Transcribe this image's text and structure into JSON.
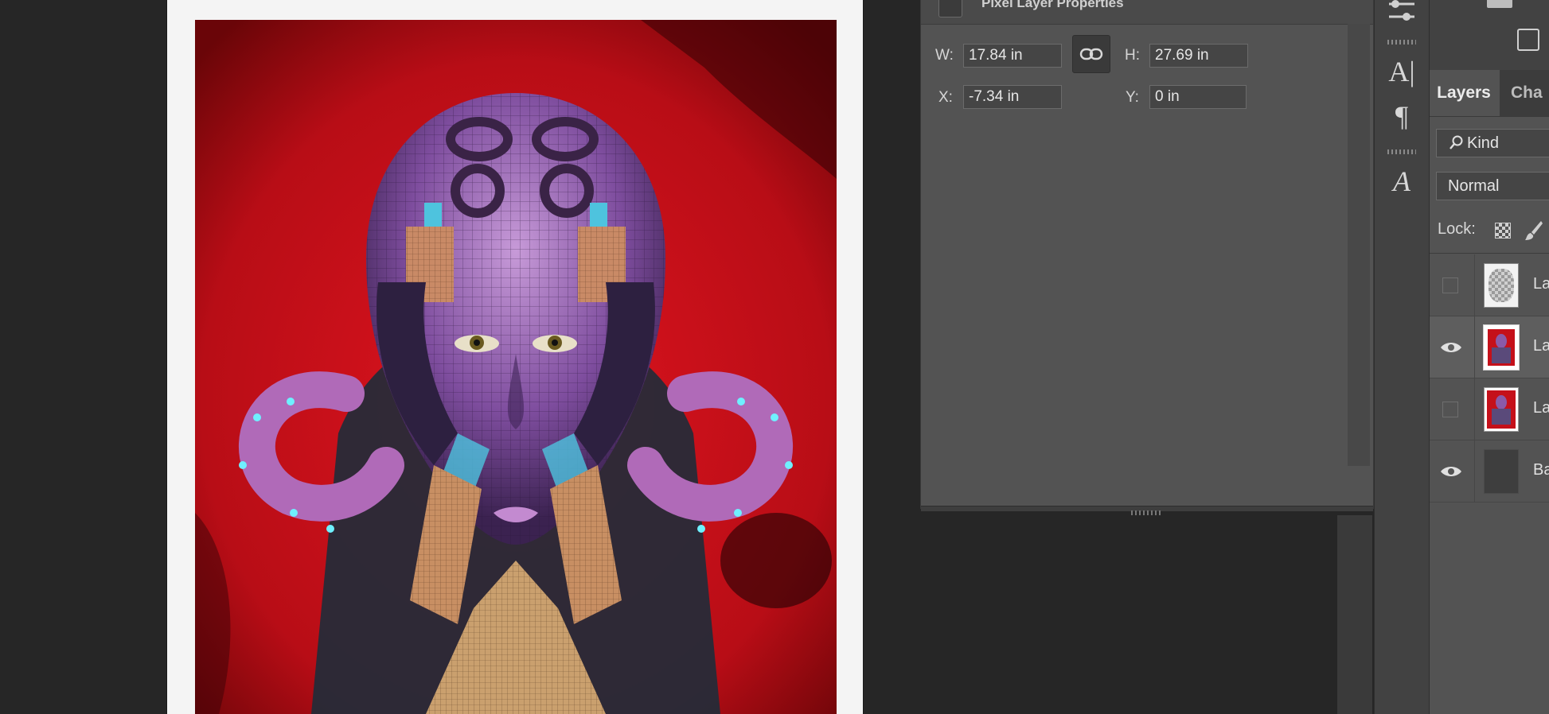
{
  "properties_panel": {
    "title": "Pixel Layer Properties",
    "width_label": "W:",
    "width_value": "17.84 in",
    "height_label": "H:",
    "height_value": "27.69 in",
    "x_label": "X:",
    "x_value": "-7.34 in",
    "y_label": "Y:",
    "y_value": "0 in",
    "link_icon": "link-icon"
  },
  "tool_strip": {
    "tools": [
      "adjust-sliders-icon",
      "character-icon",
      "paragraph-icon",
      "glyphs-icon"
    ],
    "character_glyph": "A|",
    "paragraph_glyph": "¶",
    "glyphs_glyph": "A"
  },
  "layers_panel": {
    "tab_layers": "Layers",
    "tab_channels": "Cha",
    "filter_label": "Kind",
    "blend_mode": "Normal",
    "lock_label": "Lock:",
    "layers": [
      {
        "name": "La",
        "visible": false,
        "selected": false,
        "thumb": "mask"
      },
      {
        "name": "La",
        "visible": true,
        "selected": true,
        "thumb": "art"
      },
      {
        "name": "La",
        "visible": false,
        "selected": false,
        "thumb": "art"
      },
      {
        "name": "Ba",
        "visible": true,
        "selected": false,
        "thumb": "background"
      }
    ]
  },
  "colors": {
    "panel_bg": "#535353",
    "app_bg": "#262626",
    "artwork_red": "#c5101a",
    "artwork_purple": "#8a5aa8"
  }
}
